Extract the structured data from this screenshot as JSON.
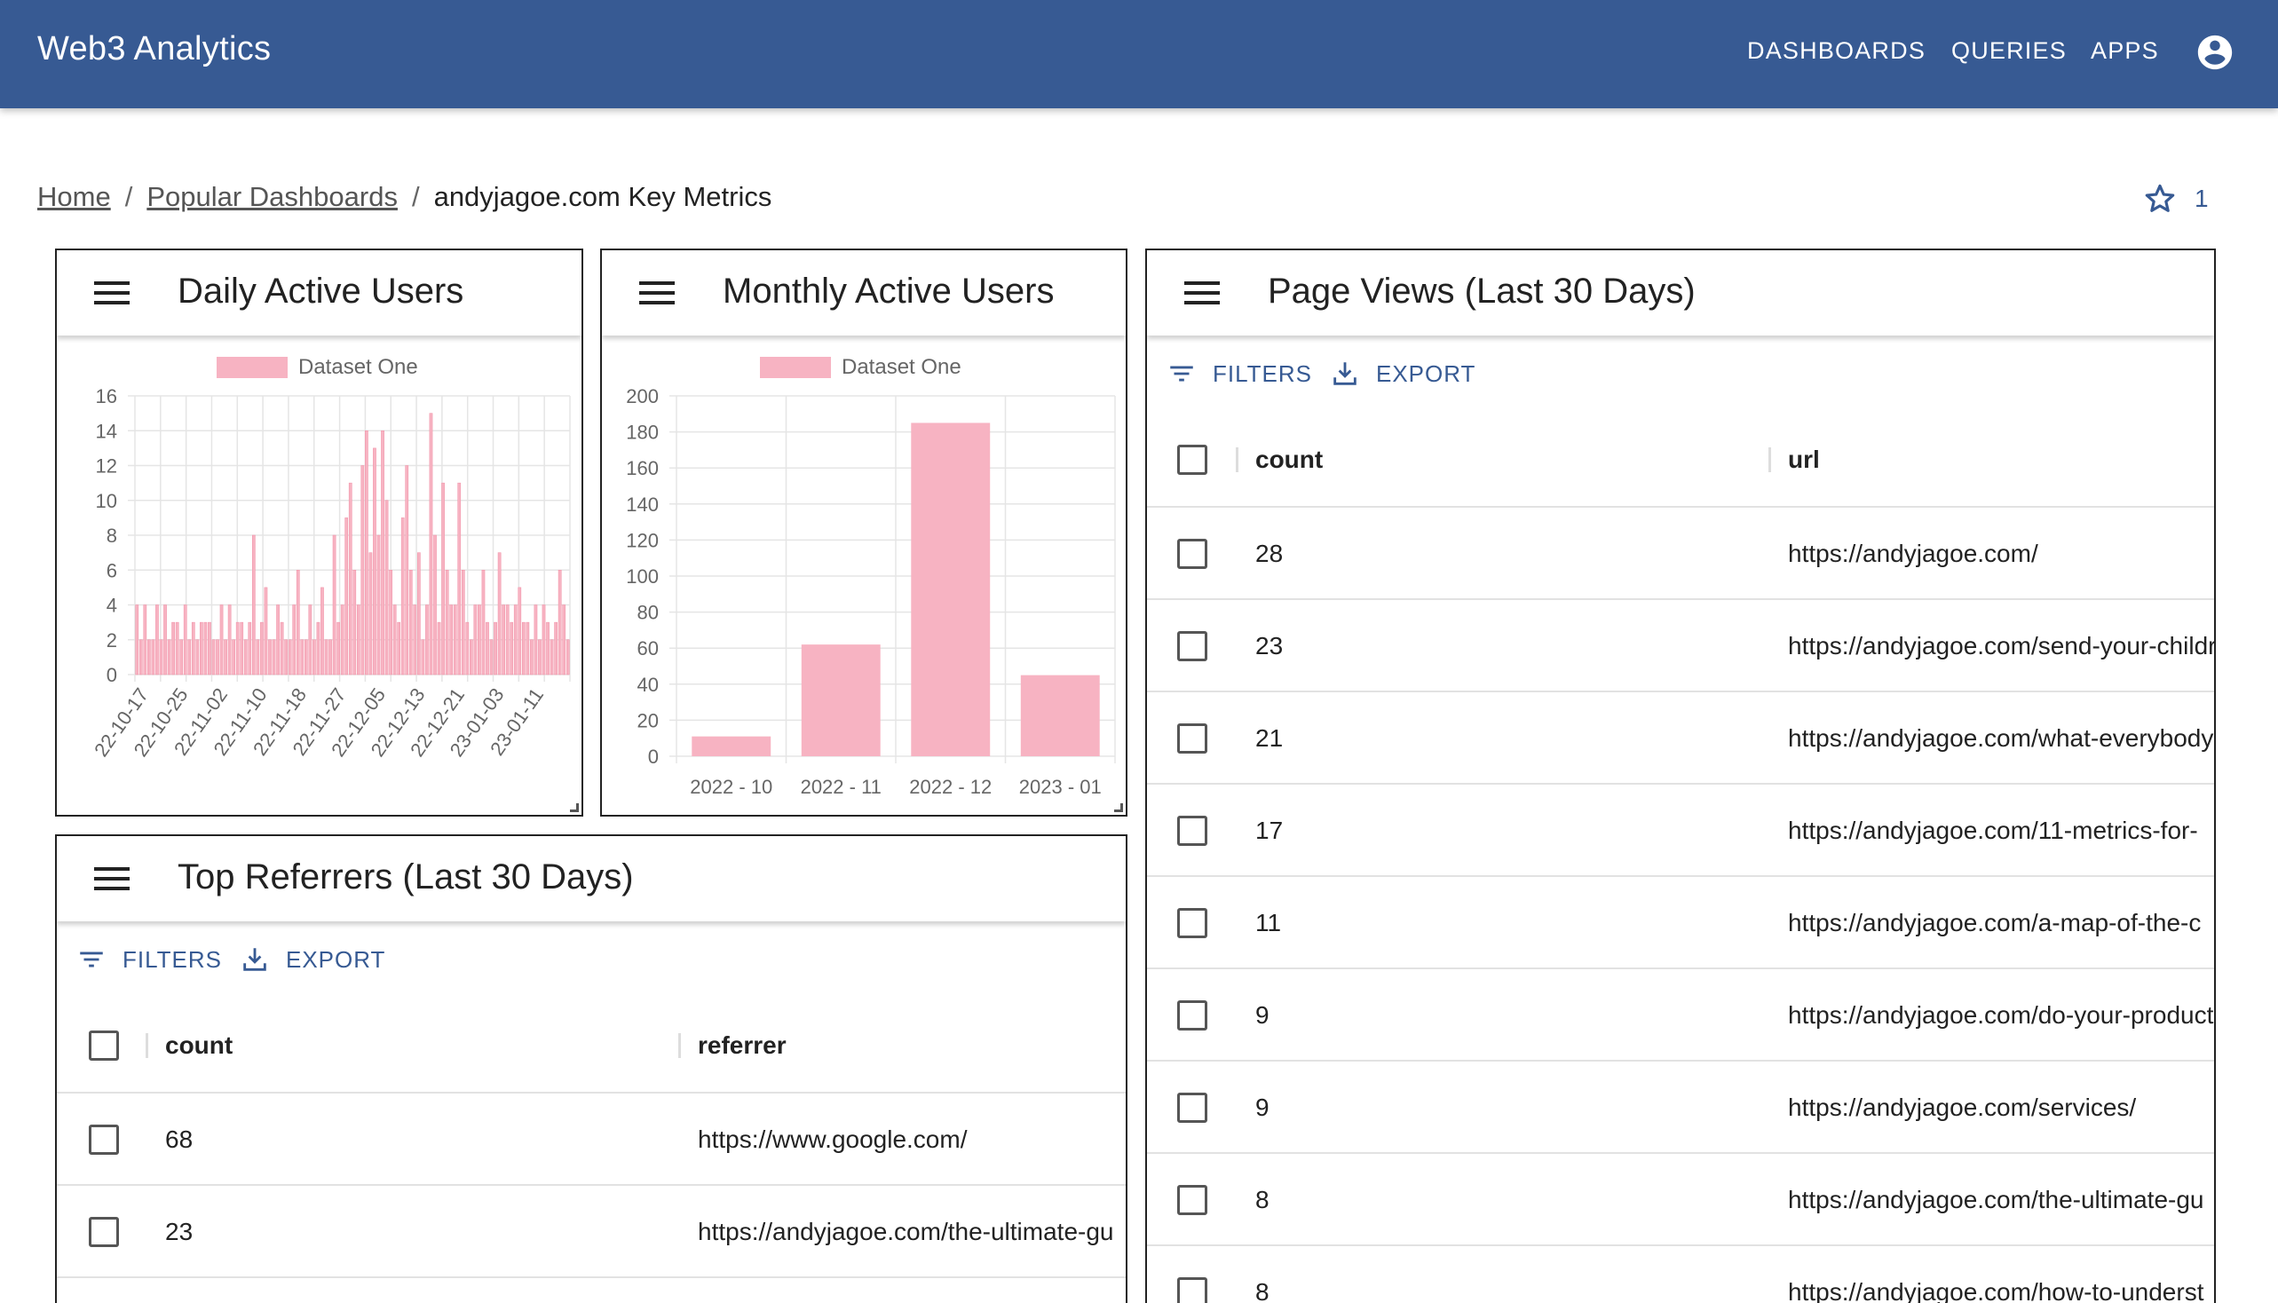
{
  "app": {
    "title": "Web3 Analytics"
  },
  "nav": {
    "dashboards": "DASHBOARDS",
    "queries": "QUERIES",
    "apps": "APPS",
    "account_icon": "account-circle-icon"
  },
  "breadcrumb": {
    "home": "Home",
    "popular": "Popular Dashboards",
    "current": "andyjagoe.com Key Metrics"
  },
  "star": {
    "count": "1",
    "icon": "star-outline-icon"
  },
  "colors": {
    "appbar": "#375a93",
    "bar": "#f7b3c2",
    "accent": "#375a93"
  },
  "panels": {
    "daily": {
      "title": "Daily Active Users",
      "legend": "Dataset One"
    },
    "monthly": {
      "title": "Monthly Active Users",
      "legend": "Dataset One"
    },
    "pageviews": {
      "title": "Page Views (Last 30 Days)",
      "filters": "FILTERS",
      "export": "EXPORT",
      "col_count": "count",
      "col_url": "url",
      "rows": [
        {
          "count": "28",
          "url": "https://andyjagoe.com/"
        },
        {
          "count": "23",
          "url": "https://andyjagoe.com/send-your-children-to"
        },
        {
          "count": "21",
          "url": "https://andyjagoe.com/what-everybody-ought"
        },
        {
          "count": "17",
          "url": "https://andyjagoe.com/11-metrics-for-"
        },
        {
          "count": "11",
          "url": "https://andyjagoe.com/a-map-of-the-c"
        },
        {
          "count": "9",
          "url": "https://andyjagoe.com/do-your-product"
        },
        {
          "count": "9",
          "url": "https://andyjagoe.com/services/"
        },
        {
          "count": "8",
          "url": "https://andyjagoe.com/the-ultimate-gu"
        },
        {
          "count": "8",
          "url": "https://andyjagoe.com/how-to-underst"
        }
      ]
    },
    "referrers": {
      "title": "Top Referrers (Last 30 Days)",
      "filters": "FILTERS",
      "export": "EXPORT",
      "col_count": "count",
      "col_ref": "referrer",
      "rows": [
        {
          "count": "68",
          "ref": "https://www.google.com/"
        },
        {
          "count": "23",
          "ref": "https://andyjagoe.com/the-ultimate-gu"
        }
      ]
    }
  },
  "chart_data": [
    {
      "type": "bar",
      "title": "Daily Active Users",
      "series": [
        {
          "name": "Dataset One",
          "values": [
            4,
            2,
            4,
            2,
            2,
            4,
            2,
            4,
            2,
            3,
            3,
            2,
            4,
            2,
            3,
            2,
            3,
            3,
            3,
            2,
            2,
            4,
            2,
            4,
            2,
            3,
            3,
            2,
            3,
            8,
            2,
            3,
            5,
            2,
            2,
            4,
            3,
            2,
            2,
            4,
            6,
            2,
            2,
            4,
            2,
            3,
            5,
            2,
            2,
            8,
            3,
            4,
            9,
            11,
            6,
            4,
            12,
            14,
            7,
            13,
            8,
            14,
            10,
            6,
            4,
            3,
            9,
            12,
            6,
            4,
            7,
            2,
            4,
            15,
            8,
            3,
            11,
            6,
            4,
            4,
            11,
            6,
            3,
            2,
            4,
            4,
            6,
            3,
            2,
            3,
            7,
            4,
            4,
            3,
            4,
            5,
            3,
            3,
            2,
            4,
            2,
            4,
            3,
            2,
            3,
            6,
            4,
            2
          ]
        }
      ],
      "tick_labels": [
        "22-10-17",
        "22-10-25",
        "22-11-02",
        "22-11-10",
        "22-11-18",
        "22-11-27",
        "22-12-05",
        "22-12-13",
        "22-12-21",
        "23-01-03",
        "23-01-11"
      ],
      "ylim": [
        0,
        16
      ],
      "yticks": [
        0,
        2,
        4,
        6,
        8,
        10,
        12,
        14,
        16
      ],
      "grid": true,
      "legend": "top"
    },
    {
      "type": "bar",
      "title": "Monthly Active Users",
      "categories": [
        "2022 - 10",
        "2022 - 11",
        "2022 - 12",
        "2023 - 01"
      ],
      "series": [
        {
          "name": "Dataset One",
          "values": [
            11,
            62,
            185,
            45
          ]
        }
      ],
      "ylim": [
        0,
        200
      ],
      "yticks": [
        0,
        20,
        40,
        60,
        80,
        100,
        120,
        140,
        160,
        180,
        200
      ],
      "grid": true,
      "legend": "top"
    }
  ]
}
